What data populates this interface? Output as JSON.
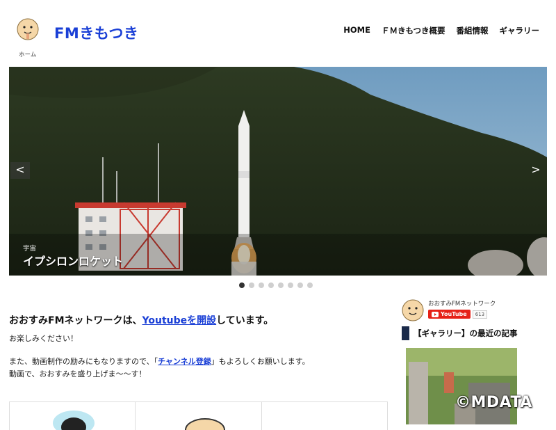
{
  "header": {
    "site_title": "FMきもつき",
    "nav": [
      "HOME",
      "ＦＭきもつき概要",
      "番組情報",
      "ギャラリー"
    ],
    "breadcrumb": "ホーム"
  },
  "slider": {
    "category": "宇宙",
    "title": "イプシロンロケット",
    "prev_label": "<",
    "next_label": ">",
    "slide_count": 8,
    "active_index": 0
  },
  "main": {
    "headline_pre": "おおすみFMネットワークは、",
    "headline_link": "Youtubeを開設",
    "headline_post": "しています。",
    "line1": "お楽しみください！",
    "line2_pre": "また、動画制作の励みにもなりますので、「",
    "line2_link": "チャンネル登録",
    "line2_post": "」もよろしくお願いします。",
    "line3": "動画で、おおすみを盛り上げま～～す！"
  },
  "sidebar": {
    "channel_name": "おおすみFMネットワーク",
    "youtube_label": "YouTube",
    "subscriber_count": "613",
    "recent_heading": "【ギャラリー】の最近の記事"
  },
  "watermark": "©MDATA",
  "colors": {
    "title_blue": "#1a3fd6",
    "heading_bar": "#1a2a4a",
    "youtube_red": "#e62117"
  }
}
